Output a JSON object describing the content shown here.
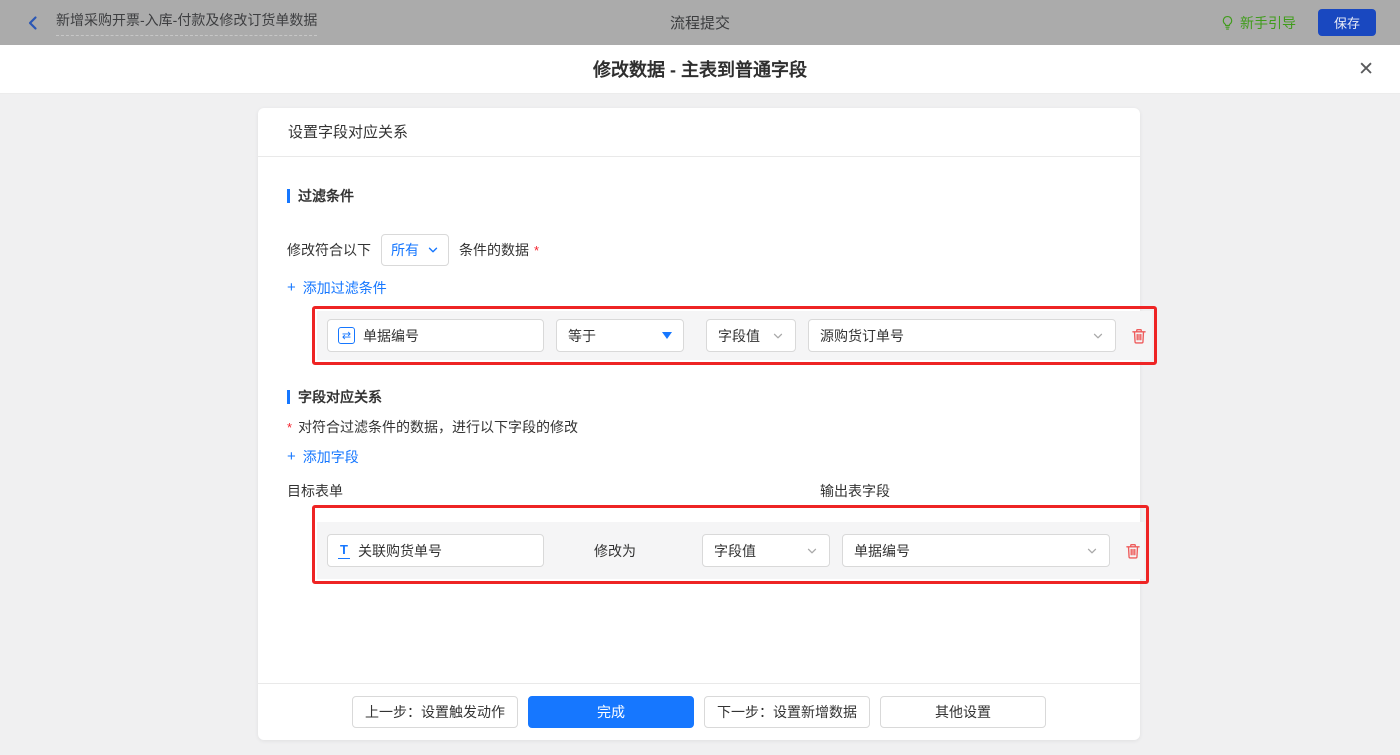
{
  "icons": {
    "plus": "+",
    "close": "✕",
    "swap_glyph": "⇄",
    "text_glyph": "T",
    "asterisk": "*"
  },
  "topbar": {
    "workflow_title": "新增采购开票-入库-付款及修改订货单数据",
    "page_title": "流程提交",
    "guide_label": "新手引导",
    "save_label": "保存"
  },
  "modal": {
    "title": "修改数据 - 主表到普通字段"
  },
  "card": {
    "header_title": "设置字段对应关系",
    "filter": {
      "section_title": "过滤条件",
      "match_prefix": "修改符合以下",
      "match_scope": "所有",
      "match_suffix": "条件的数据",
      "add_label": "添加过滤条件",
      "row": {
        "field": "单据编号",
        "operator": "等于",
        "value_type": "字段值",
        "value_field": "源购货订单号"
      }
    },
    "mapping": {
      "section_title": "字段对应关系",
      "description": "对符合过滤条件的数据，进行以下字段的修改",
      "add_label": "添加字段",
      "target_form_label": "目标表单",
      "output_field_label": "输出表字段",
      "row": {
        "target_field": "关联购货单号",
        "modify_label": "修改为",
        "value_type": "字段值",
        "value_field": "单据编号"
      }
    },
    "footer": {
      "prev": "上一步：设置触发动作",
      "done": "完成",
      "next": "下一步：设置新增数据",
      "other": "其他设置"
    }
  },
  "colors": {
    "primary_blue": "#1677ff",
    "save_button_blue": "#1948c0",
    "highlight_red": "#ee2424",
    "danger_red": "#ee5b5b",
    "guide_green": "#3f9c1a",
    "topbar_gray": "#ababab"
  }
}
